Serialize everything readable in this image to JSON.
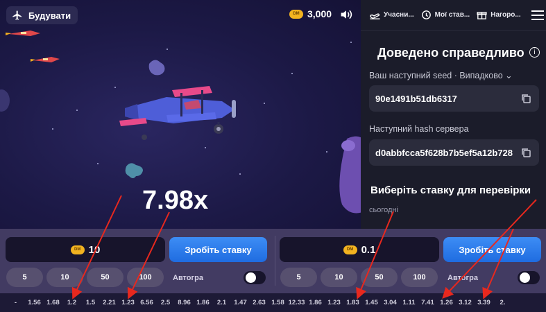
{
  "header": {
    "build_label": "Будувати",
    "balance": "3,000",
    "currency_badge": "DM"
  },
  "game": {
    "multiplier": "7.98x"
  },
  "panel": {
    "tabs": [
      {
        "label": "Учасни...",
        "icon": "plane-takeoff-icon"
      },
      {
        "label": "Мої став...",
        "icon": "history-icon"
      },
      {
        "label": "Нагоро...",
        "icon": "gift-icon"
      }
    ],
    "title": "Доведено справедливо",
    "next_seed_label": "Ваш наступний seed · Випадково",
    "next_seed_value": "90e1491b51db6317",
    "next_hash_label": "Наступний hash сервера",
    "next_hash_value": "d0abbfcca5f628b7b5ef5a12b728",
    "pick_bet_title": "Виберіть ставку для перевірки",
    "today_label": "сьогодні"
  },
  "bet1": {
    "amount": "10",
    "place_label": "Зробіть ставку",
    "quick": [
      "5",
      "10",
      "50",
      "100"
    ],
    "auto_label": "Автогра"
  },
  "bet2": {
    "amount": "0.1",
    "place_label": "Зробіть ставку",
    "quick": [
      "5",
      "10",
      "50",
      "100"
    ],
    "auto_label": "Автогра"
  },
  "history": [
    "-",
    "1.56",
    "1.68",
    "1.2",
    "1.5",
    "2.21",
    "1.23",
    "6.56",
    "2.5",
    "8.96",
    "1.86",
    "2.1",
    "1.47",
    "2.63",
    "1.58",
    "12.33",
    "1.86",
    "1.23",
    "1.83",
    "1.45",
    "3.04",
    "1.11",
    "7.41",
    "1.26",
    "3.12",
    "3.39",
    "2."
  ],
  "colors": {
    "accent_blue": "#2f7df0",
    "coin_gold": "#f2b320",
    "arrow_red": "#e8281e"
  }
}
